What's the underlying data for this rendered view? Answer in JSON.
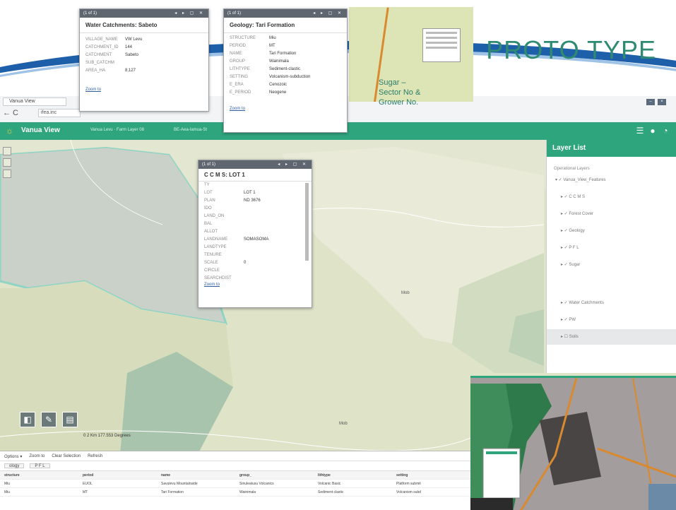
{
  "slide": {
    "title": "PROTO TYPE",
    "annotation": "Sugar –\nSector No &\nGrower No."
  },
  "browser": {
    "tab_label": "Vanua View",
    "nav_label": "← C",
    "url": "ifea.inc"
  },
  "app": {
    "title": "Vanua View",
    "subtitle_1": "Vanua Levu · Farm Layer 08",
    "subtitle_2": "BE-Aea-Iamua-St"
  },
  "popup_water": {
    "counter": "(1 of 1)",
    "title": "Water Catchments: Sabeto",
    "rows": [
      {
        "k": "VILLAGE_NAME",
        "v": "VW Levu"
      },
      {
        "k": "CATCHMENT_ID",
        "v": "144"
      },
      {
        "k": "CATCHMENT",
        "v": "Sabeto"
      },
      {
        "k": "SUB_CATCHM",
        "v": ""
      },
      {
        "k": "AREA_HA",
        "v": "8,127"
      }
    ],
    "zoom": "Zoom to"
  },
  "popup_geology": {
    "counter": "(1 of 1)",
    "title": "Geology: Tari Formation",
    "rows": [
      {
        "k": "STRUCTURE",
        "v": "Miu"
      },
      {
        "k": "PERIOD",
        "v": "MT"
      },
      {
        "k": "NAME",
        "v": "Tari Formation"
      },
      {
        "k": "GROUP",
        "v": "Wainimala"
      },
      {
        "k": "LITHTYPE",
        "v": "Sediment-clastic"
      },
      {
        "k": "SETTING",
        "v": "Volcanism-subduction"
      },
      {
        "k": "E_ERA",
        "v": "Cenozoic"
      },
      {
        "k": "E_PERIOD",
        "v": "Neogene"
      }
    ],
    "zoom": "Zoom to"
  },
  "popup_ccms": {
    "counter": "(1 of 1)",
    "title": "C C M S: LOT 1",
    "rows": [
      {
        "k": "TY",
        "v": ""
      },
      {
        "k": "LOT",
        "v": "LOT 1"
      },
      {
        "k": "PLAN",
        "v": "ND 3676"
      },
      {
        "k": "IDO",
        "v": ""
      },
      {
        "k": "LAND_ON",
        "v": ""
      },
      {
        "k": "BAL",
        "v": ""
      },
      {
        "k": "ALLOT",
        "v": ""
      },
      {
        "k": "LANDNAME",
        "v": "SOMASOMA"
      },
      {
        "k": "LANDTYPE",
        "v": ""
      },
      {
        "k": "TENURE",
        "v": ""
      },
      {
        "k": "SCALE",
        "v": "0"
      },
      {
        "k": "CIRCLE",
        "v": ""
      },
      {
        "k": "SEARCHDIST",
        "v": ""
      }
    ],
    "zoom": "Zoom to"
  },
  "layer_list": {
    "title": "Layer List",
    "operational": "Operational Layers",
    "items": [
      "Vanua_View_Features",
      "C C M S",
      "Forest Cover",
      "Geology",
      "P F L",
      "Sugar",
      "Water Catchments",
      "PW",
      "Soils"
    ]
  },
  "map": {
    "scale": "0    2 Km   177.553 Degrees",
    "label_1": "Mob",
    "label_2": "Mob"
  },
  "attr_table": {
    "toolbar": [
      "Options ▾",
      "Zoom to",
      "Clear Selection",
      "Refresh"
    ],
    "tabs": [
      "ology",
      "P F L"
    ],
    "headers": [
      "structure",
      "period",
      "name",
      "group_",
      "lithtype",
      "setting"
    ],
    "rows": [
      [
        "Miu",
        "EUOL",
        "Savulevu Mountainside",
        "Sinuleatusu Volcanics",
        "Volcanic Basic",
        "Platform submit"
      ],
      [
        "Miu",
        "MT",
        "Tari Formation",
        "Wainimala",
        "Sediment clastic",
        "Volcanism subd"
      ]
    ]
  },
  "colors": {
    "accent": "#2fa57d",
    "title": "#2f8a72",
    "swoosh": "#1d5fa8"
  }
}
